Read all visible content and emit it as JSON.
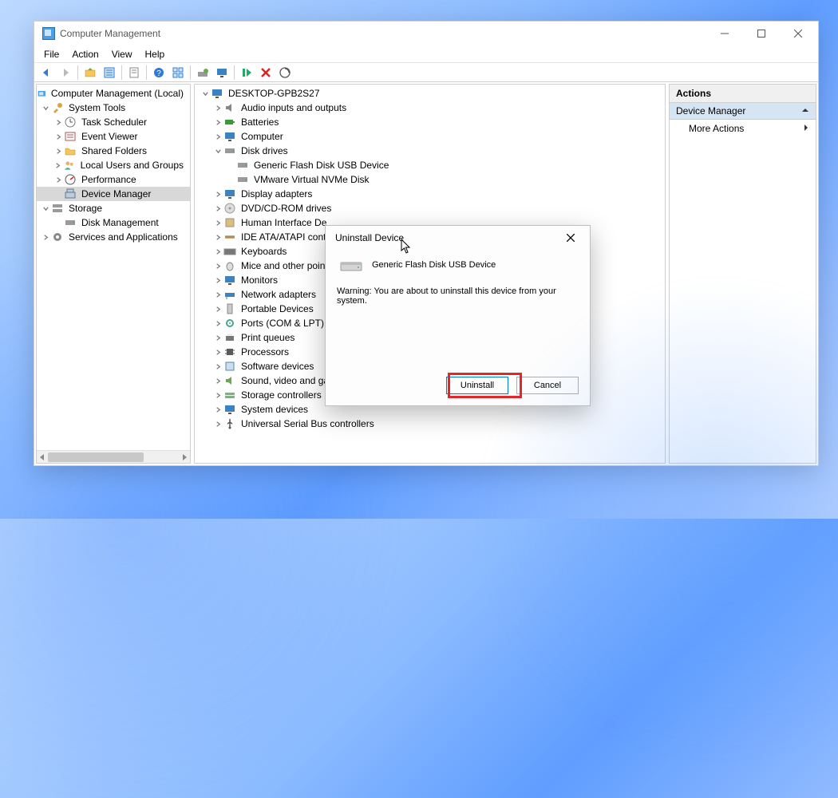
{
  "window": {
    "title": "Computer Management",
    "menus": [
      "File",
      "Action",
      "View",
      "Help"
    ]
  },
  "left_tree": {
    "root": "Computer Management (Local)",
    "system_tools": {
      "label": "System Tools",
      "children": [
        "Task Scheduler",
        "Event Viewer",
        "Shared Folders",
        "Local Users and Groups",
        "Performance",
        "Device Manager"
      ],
      "selected": "Device Manager"
    },
    "storage": {
      "label": "Storage",
      "children": [
        "Disk Management"
      ]
    },
    "services": "Services and Applications"
  },
  "device_tree": {
    "root": "DESKTOP-GPB2S27",
    "nodes": [
      {
        "label": "Audio inputs and outputs",
        "exp": false
      },
      {
        "label": "Batteries",
        "exp": false
      },
      {
        "label": "Computer",
        "exp": false
      },
      {
        "label": "Disk drives",
        "exp": true,
        "children": [
          "Generic Flash Disk USB Device",
          "VMware Virtual NVMe Disk"
        ]
      },
      {
        "label": "Display adapters",
        "exp": false
      },
      {
        "label": "DVD/CD-ROM drives",
        "exp": false
      },
      {
        "label": "Human Interface Devices",
        "exp": false,
        "clipped": "Human Interface De"
      },
      {
        "label": "IDE ATA/ATAPI controllers",
        "exp": false,
        "clipped": "IDE ATA/ATAPI contr"
      },
      {
        "label": "Keyboards",
        "exp": false
      },
      {
        "label": "Mice and other pointing devices",
        "exp": false,
        "clipped": "Mice and other poin"
      },
      {
        "label": "Monitors",
        "exp": false
      },
      {
        "label": "Network adapters",
        "exp": false
      },
      {
        "label": "Portable Devices",
        "exp": false
      },
      {
        "label": "Ports (COM & LPT)",
        "exp": false
      },
      {
        "label": "Print queues",
        "exp": false
      },
      {
        "label": "Processors",
        "exp": false
      },
      {
        "label": "Software devices",
        "exp": false
      },
      {
        "label": "Sound, video and game controllers",
        "exp": false,
        "clipped": "Sound, video and ga"
      },
      {
        "label": "Storage controllers",
        "exp": false
      },
      {
        "label": "System devices",
        "exp": false
      },
      {
        "label": "Universal Serial Bus controllers",
        "exp": false
      }
    ]
  },
  "actions": {
    "header": "Actions",
    "section": "Device Manager",
    "item": "More Actions"
  },
  "dialog": {
    "title": "Uninstall Device",
    "device": "Generic Flash Disk USB Device",
    "warning": "Warning: You are about to uninstall this device from your system.",
    "primary": "Uninstall",
    "secondary": "Cancel"
  },
  "toolbar_icons": [
    "back",
    "forward",
    "|",
    "up",
    "properties",
    "|",
    "export",
    "|",
    "help",
    "tile",
    "|",
    "refresh",
    "monitor",
    "|",
    "play",
    "delete",
    "scan"
  ]
}
